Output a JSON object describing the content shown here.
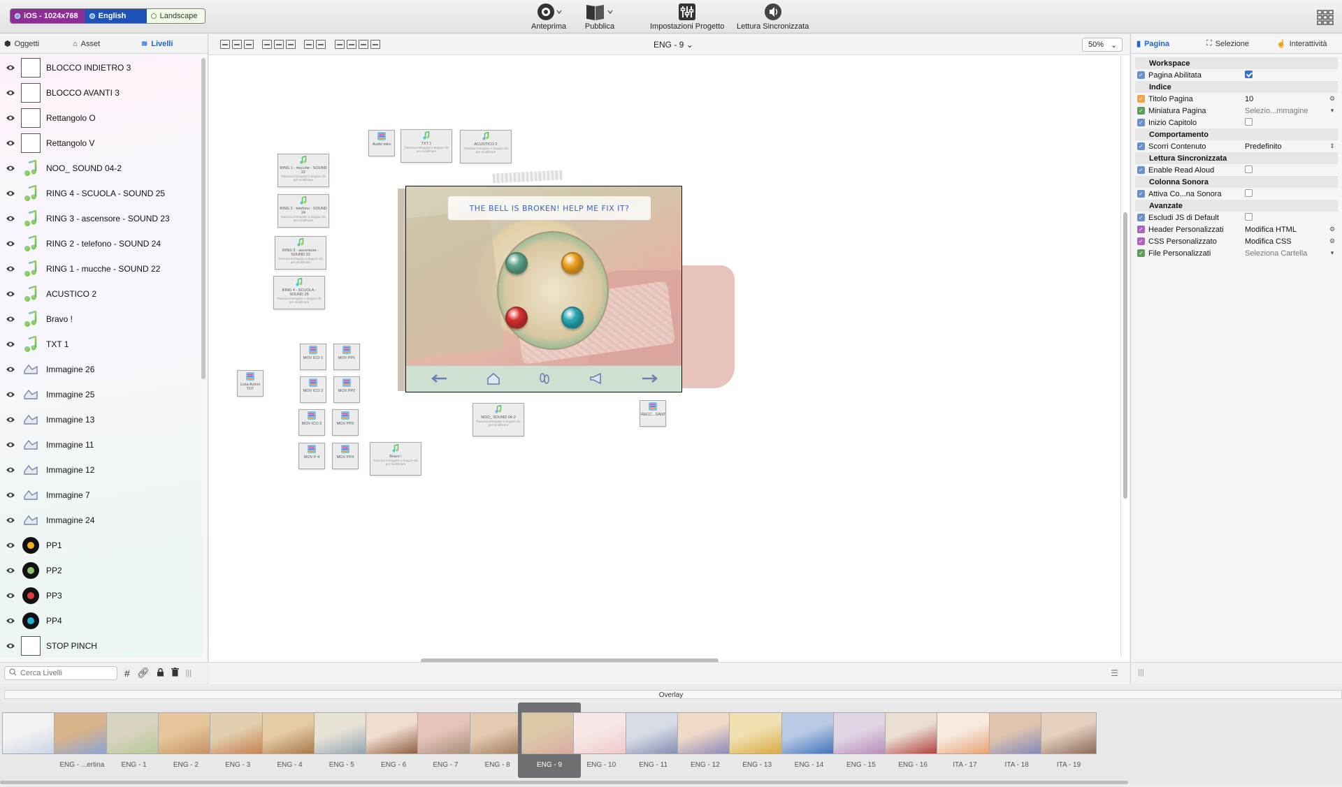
{
  "toolbar": {
    "device": "iOS - 1024x768",
    "language": "English",
    "orientation": "Landscape",
    "preview": "Anteprima",
    "publish": "Pubblica",
    "settings": "Impostazioni Progetto",
    "readaloud": "Lettura Sincronizzata"
  },
  "left": {
    "tabs": [
      "Oggetti",
      "Asset",
      "Livelli"
    ],
    "layers": [
      {
        "name": "BLOCCO INDIETRO 3",
        "kind": "box"
      },
      {
        "name": "BLOCCO AVANTI 3",
        "kind": "box"
      },
      {
        "name": "Rettangolo O",
        "kind": "box"
      },
      {
        "name": "Rettangolo V",
        "kind": "box"
      },
      {
        "name": "NOO_ SOUND 04-2",
        "kind": "note"
      },
      {
        "name": "RING 4 - SCUOLA - SOUND 25",
        "kind": "note"
      },
      {
        "name": "RING 3 - ascensore - SOUND 23",
        "kind": "note"
      },
      {
        "name": "RING 2 - telefono - SOUND 24",
        "kind": "note"
      },
      {
        "name": "RING 1 - mucche - SOUND 22",
        "kind": "note"
      },
      {
        "name": "ACUSTICO 2",
        "kind": "note"
      },
      {
        "name": "Bravo !",
        "kind": "note"
      },
      {
        "name": "TXT 1",
        "kind": "note"
      },
      {
        "name": "Immagine 26",
        "kind": "img"
      },
      {
        "name": "Immagine 25",
        "kind": "img"
      },
      {
        "name": "Immagine 13",
        "kind": "img"
      },
      {
        "name": "Immagine 11",
        "kind": "img"
      },
      {
        "name": "Immagine 12",
        "kind": "img"
      },
      {
        "name": "Immagine 7",
        "kind": "img"
      },
      {
        "name": "Immagine 24",
        "kind": "img"
      },
      {
        "name": "PP1",
        "kind": "dot",
        "color": "#f4b21a"
      },
      {
        "name": "PP2",
        "kind": "dot",
        "color": "#8fc46a"
      },
      {
        "name": "PP3",
        "kind": "dot",
        "color": "#e23b3b"
      },
      {
        "name": "PP4",
        "kind": "dot",
        "color": "#1fb3d6"
      },
      {
        "name": "STOP PINCH",
        "kind": "box"
      }
    ],
    "search_placeholder": "Cerca Livelli"
  },
  "center": {
    "page_selector": "ENG - 9",
    "zoom": "50%",
    "banner_text": "THE BELL IS BROKEN! HELP ME FIX IT?",
    "hint": "Trascina immagine o doppio-clic per modificare",
    "objects": [
      {
        "label": "Audio intro",
        "kind": "list"
      },
      {
        "label": "TXT 1",
        "kind": "note"
      },
      {
        "label": "ACUSTICO 2",
        "kind": "note"
      },
      {
        "label": "RING 1 - mucche - SOUND 22",
        "kind": "note"
      },
      {
        "label": "RING 2 - telefono - SOUND 24",
        "kind": "note"
      },
      {
        "label": "RING 3 - ascensore - SOUND 23",
        "kind": "note"
      },
      {
        "label": "RING 4 - SCUOLA - SOUND 25",
        "kind": "note"
      },
      {
        "label": "Lista Azioni TOT",
        "kind": "list"
      },
      {
        "label": "MOV ICO 1",
        "kind": "list"
      },
      {
        "label": "MOV PP1",
        "kind": "list"
      },
      {
        "label": "MOV ICO 2",
        "kind": "list"
      },
      {
        "label": "MOV PP2",
        "kind": "list"
      },
      {
        "label": "MOV ICO 3",
        "kind": "list"
      },
      {
        "label": "MOV PP3",
        "kind": "list"
      },
      {
        "label": "MOV P 4",
        "kind": "list"
      },
      {
        "label": "MOV PP4",
        "kind": "list"
      },
      {
        "label": "Bravo !",
        "kind": "note"
      },
      {
        "label": "NOO_ SOUND 04-2",
        "kind": "note"
      },
      {
        "label": "FRECC...SANTI",
        "kind": "list"
      }
    ],
    "ball_colors": [
      "#5ea48a",
      "#f0a020",
      "#d83030",
      "#2aa8b4"
    ]
  },
  "right": {
    "tabs": [
      "Pagina",
      "Selezione",
      "Interattività"
    ],
    "sections": [
      {
        "title": "Workspace",
        "rows": [
          {
            "label": "Pagina Abilitata",
            "type": "check",
            "on": true,
            "icon": "#6b8fc9"
          }
        ]
      },
      {
        "title": "Indice",
        "rows": [
          {
            "label": "Titolo Pagina",
            "type": "text",
            "value": "10",
            "action": "⚙",
            "icon": "#f0a14a"
          },
          {
            "label": "Miniatura Pagina",
            "type": "text",
            "value": "Selezio...mmagine",
            "muted": true,
            "action": "▾",
            "icon": "#5aa05a"
          },
          {
            "label": "Inizio Capitolo",
            "type": "check",
            "on": false,
            "icon": "#6b8fc9"
          }
        ]
      },
      {
        "title": "Comportamento",
        "rows": [
          {
            "label": "Scorri Contenuto",
            "type": "text",
            "value": "Predefinito",
            "action": "⇕",
            "icon": "#6b8fc9"
          }
        ]
      },
      {
        "title": "Lettura Sincronizzata",
        "rows": [
          {
            "label": "Enable Read Aloud",
            "type": "check",
            "on": false,
            "icon": "#6b8fc9"
          }
        ]
      },
      {
        "title": "Colonna Sonora",
        "rows": [
          {
            "label": "Attiva Co...na Sonora",
            "type": "check",
            "on": false,
            "icon": "#6b8fc9"
          }
        ]
      },
      {
        "title": "Avanzate",
        "rows": [
          {
            "label": "Escludi JS di Default",
            "type": "check",
            "on": false,
            "icon": "#6b8fc9"
          },
          {
            "label": "Header Personalizzati",
            "type": "text",
            "value": "Modifica HTML",
            "action": "⚙",
            "icon": "#b061c4"
          },
          {
            "label": "CSS Personalizzato",
            "type": "text",
            "value": "Modifica CSS",
            "action": "⚙",
            "icon": "#b061c4"
          },
          {
            "label": "File Personalizzati",
            "type": "text",
            "value": "Seleziona Cartella",
            "muted": true,
            "action": "▾",
            "icon": "#5aa05a"
          }
        ]
      }
    ]
  },
  "bottom": {
    "overlay": "Overlay",
    "slides": [
      {
        "label": "",
        "colors": [
          "#f3f3f3",
          "#c9d3e6"
        ]
      },
      {
        "label": "ENG - ...ertina",
        "colors": [
          "#d9b48a",
          "#8aa3d8"
        ]
      },
      {
        "label": "ENG - 1",
        "colors": [
          "#d9d4bf",
          "#b5c79a"
        ]
      },
      {
        "label": "ENG - 2",
        "colors": [
          "#e6c69a",
          "#c49060"
        ]
      },
      {
        "label": "ENG - 3",
        "colors": [
          "#e2cfb0",
          "#c67e4c"
        ]
      },
      {
        "label": "ENG - 4",
        "colors": [
          "#e5cba6",
          "#a67548"
        ]
      },
      {
        "label": "ENG - 5",
        "colors": [
          "#e8e2d6",
          "#8ea3b2"
        ]
      },
      {
        "label": "ENG - 6",
        "colors": [
          "#f1dcd0",
          "#8a5a3a"
        ]
      },
      {
        "label": "ENG - 7",
        "colors": [
          "#e7c3bb",
          "#a48c74"
        ]
      },
      {
        "label": "ENG - 8",
        "colors": [
          "#e5c9b0",
          "#9c7a5c"
        ]
      },
      {
        "label": "ENG - 9",
        "colors": [
          "#dcc9a8",
          "#d9a8a0"
        ],
        "active": true
      },
      {
        "label": "ENG - 10",
        "colors": [
          "#f7e7e7",
          "#efc8c8"
        ]
      },
      {
        "label": "ENG - 11",
        "colors": [
          "#d8dce6",
          "#7f8bb0"
        ]
      },
      {
        "label": "ENG - 12",
        "colors": [
          "#efd9c8",
          "#8b86b8"
        ]
      },
      {
        "label": "ENG - 13",
        "colors": [
          "#f1e0b0",
          "#d8a840"
        ]
      },
      {
        "label": "ENG - 14",
        "colors": [
          "#b9cae6",
          "#3d6fb8"
        ]
      },
      {
        "label": "ENG - 15",
        "colors": [
          "#e2d6e6",
          "#b889b8"
        ]
      },
      {
        "label": "ENG - 16",
        "colors": [
          "#eadfd2",
          "#b03a3a"
        ]
      },
      {
        "label": "ITA - 17",
        "colors": [
          "#f7eadf",
          "#e8a070"
        ]
      },
      {
        "label": "ITA - 18",
        "colors": [
          "#e0c4b0",
          "#7f86b8"
        ]
      },
      {
        "label": "ITA - 19",
        "colors": [
          "#e6d0c0",
          "#8a6a58"
        ]
      }
    ]
  }
}
